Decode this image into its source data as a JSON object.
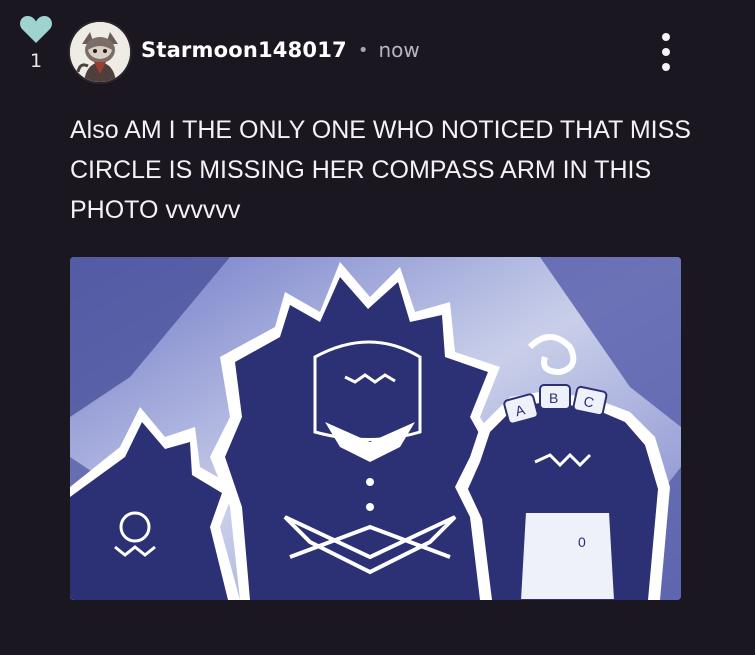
{
  "like": {
    "count": "1"
  },
  "post": {
    "username": "Starmoon148017",
    "separator": "•",
    "timestamp": "now",
    "text": "Also AM I THE ONLY ONE WHO NOTICED THAT MISS CIRCLE IS MISSING HER COMPASS ARM IN THIS PHOTO vvvvvv",
    "image": {
      "blocks": [
        "A",
        "B",
        "C"
      ],
      "shirt_mark": "0"
    }
  },
  "colors": {
    "background": "#1b1720",
    "heart": "#9fd3cf",
    "text": "#f3f2f5",
    "muted": "#b9b5c0",
    "image_navy": "#2c3074"
  },
  "icons": {
    "like": "heart-icon",
    "menu": "more-vertical-icon"
  }
}
